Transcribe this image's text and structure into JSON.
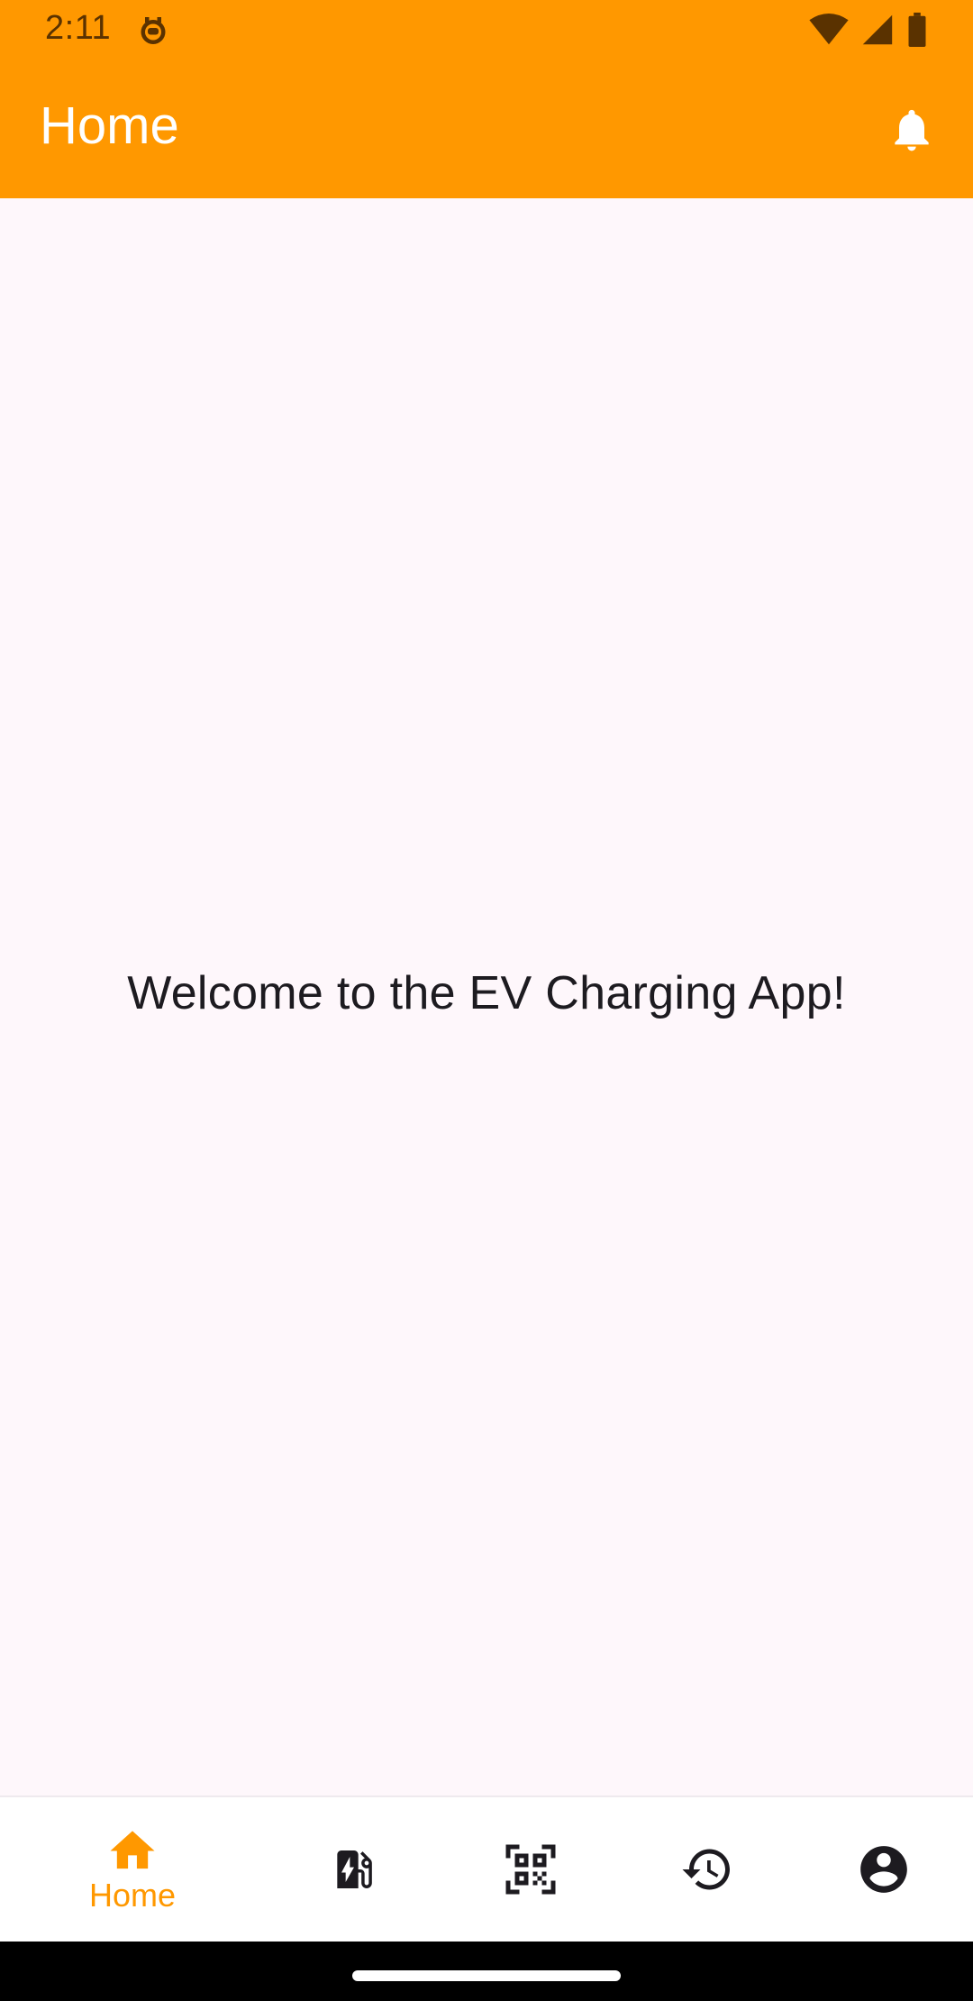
{
  "status_bar": {
    "time": "2:11"
  },
  "app_bar": {
    "title": "Home"
  },
  "main": {
    "welcome_text": "Welcome to the EV Charging App!"
  },
  "bottom_nav": {
    "items": [
      {
        "label": "Home",
        "icon": "home-icon",
        "selected": true
      },
      {
        "label": "",
        "icon": "ev-station-icon",
        "selected": false
      },
      {
        "label": "",
        "icon": "qr-code-scanner-icon",
        "selected": false
      },
      {
        "label": "",
        "icon": "history-icon",
        "selected": false
      },
      {
        "label": "",
        "icon": "account-circle-icon",
        "selected": false
      }
    ]
  },
  "colors": {
    "accent": "#FF9800",
    "background": "#FEF7FB",
    "text": "#1D1B20",
    "nav_background": "#FFFFFF"
  }
}
